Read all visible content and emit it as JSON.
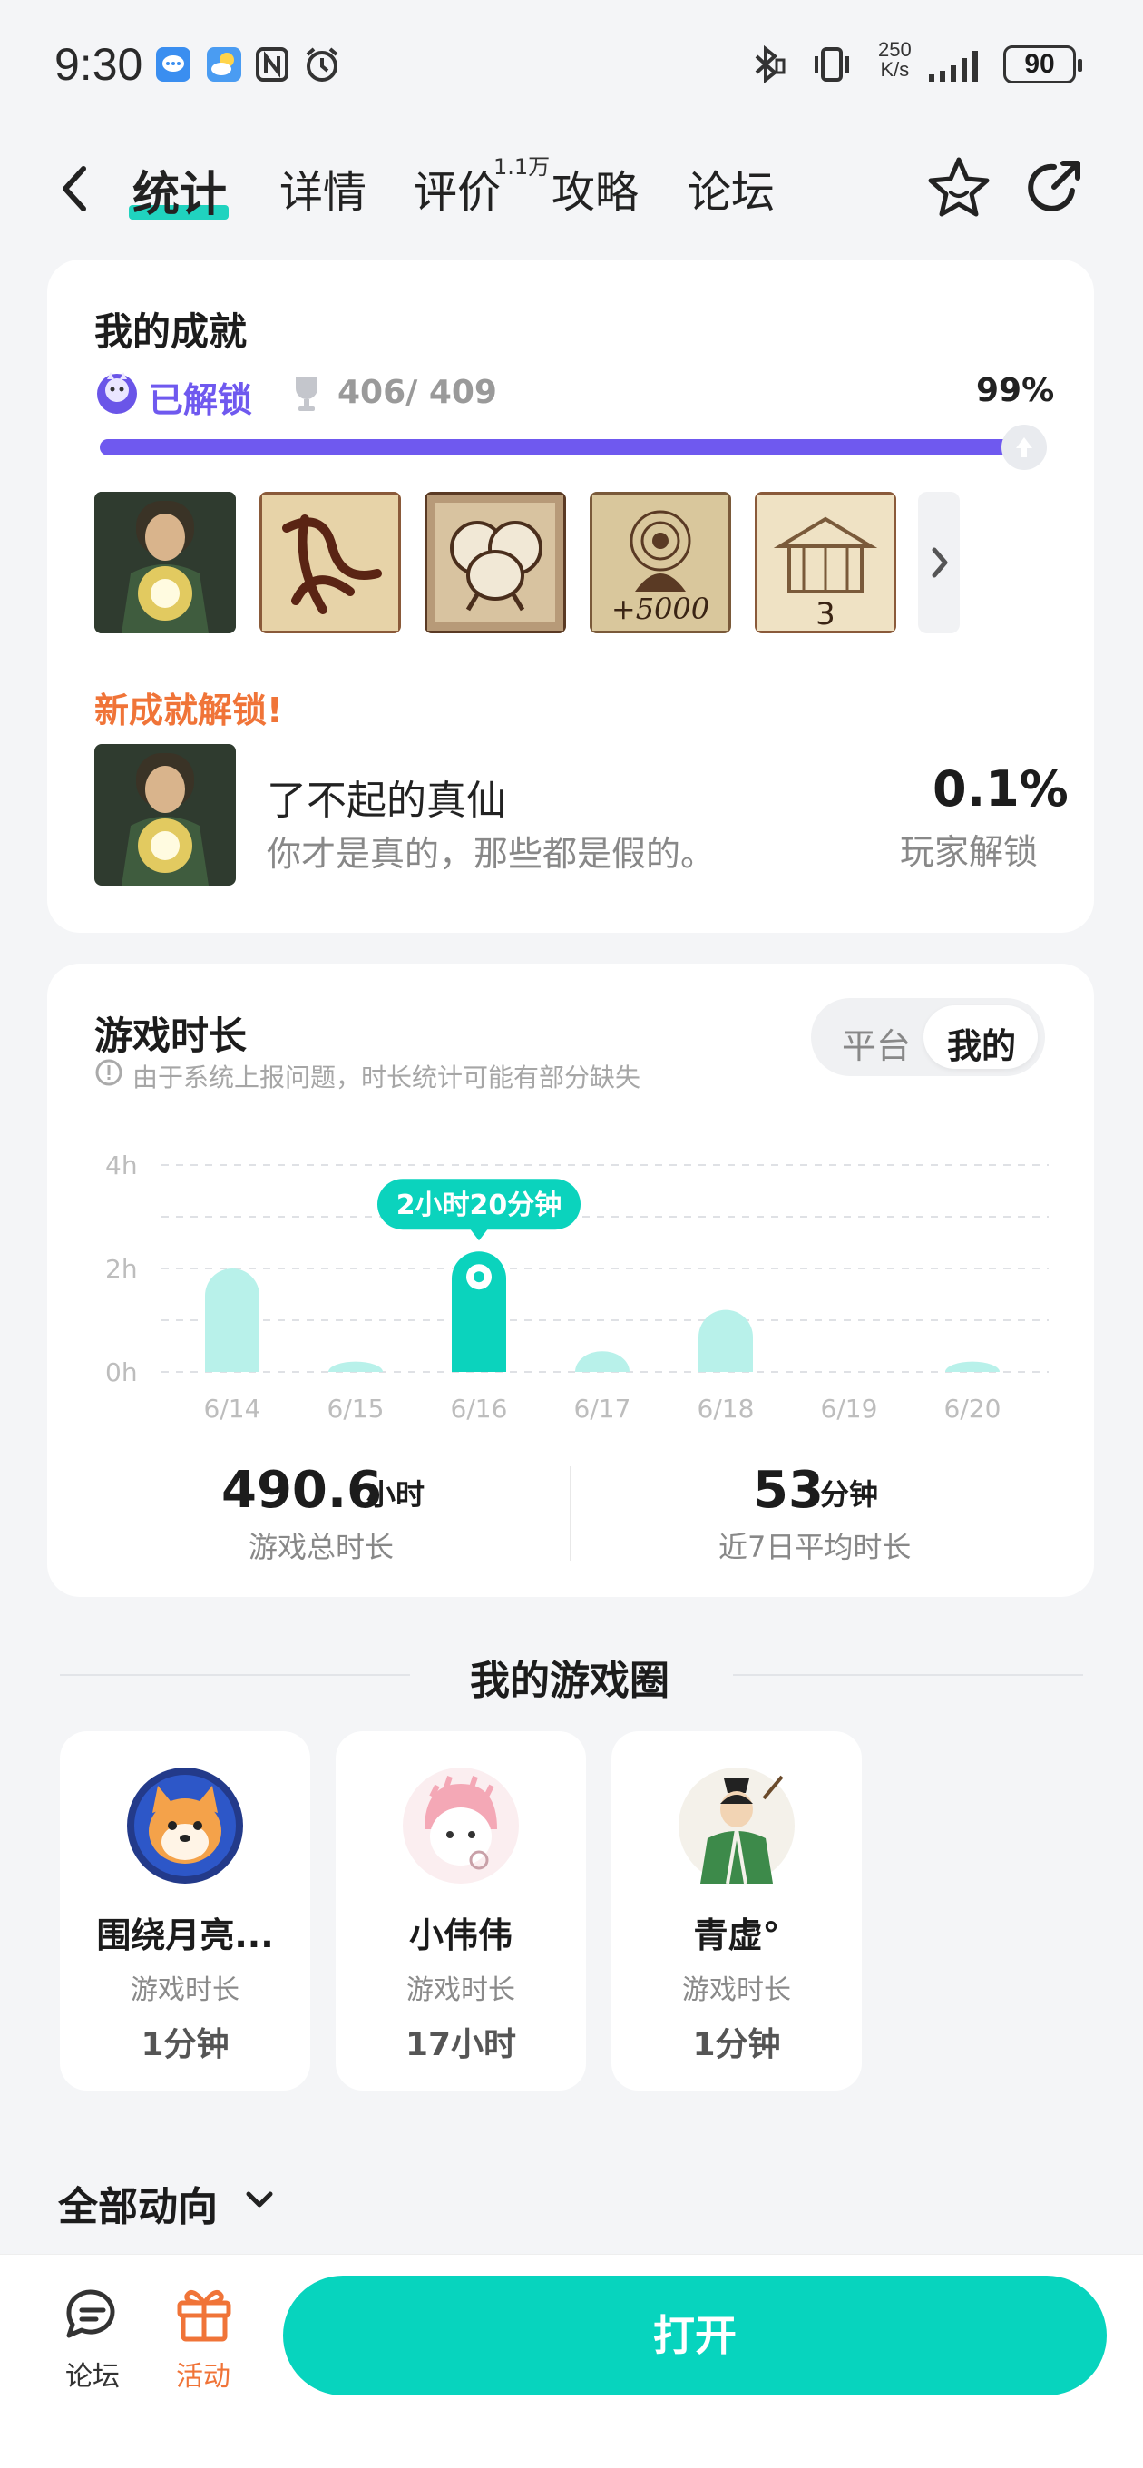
{
  "status_bar": {
    "time": "9:30",
    "net_speed_value": "250",
    "net_speed_unit": "K/s",
    "battery": "90",
    "icons": [
      "messages-icon",
      "weather-icon",
      "nfc-icon",
      "alarm-icon",
      "bluetooth-icon",
      "vibrate-icon",
      "signal-icon",
      "battery-icon"
    ]
  },
  "nav": {
    "tabs": [
      "统计",
      "详情",
      "评价",
      "攻略",
      "论坛"
    ],
    "active_tab": "统计",
    "reviews_badge": "1.1万"
  },
  "achievements": {
    "title": "我的成就",
    "unlocked_label": "已解锁",
    "count": "406/ 409",
    "percent": "99%",
    "progress_fraction": 0.99,
    "thumbnails": [
      "cultivator-immortal",
      "ink-swirl",
      "dancing-cat",
      "meditating-monk-5000",
      "temple-3"
    ],
    "new_label": "新成就解锁!",
    "new_title": "了不起的真仙",
    "new_desc": "你才是真的，那些都是假的。",
    "new_rate": "0.1%",
    "new_rate_label": "玩家解锁"
  },
  "playtime": {
    "title": "游戏时长",
    "notice": "由于系统上报问题，时长统计可能有部分缺失",
    "seg_platform": "平台",
    "seg_mine": "我的",
    "tooltip": "2小时20分钟",
    "total_value": "490.6",
    "total_unit": "小时",
    "total_label": "游戏总时长",
    "avg_value": "53",
    "avg_unit": "分钟",
    "avg_label": "近7日平均时长"
  },
  "chart_data": {
    "type": "bar",
    "categories": [
      "6/14",
      "6/15",
      "6/16",
      "6/17",
      "6/18",
      "6/19",
      "6/20"
    ],
    "values": [
      2.0,
      0.2,
      2.33,
      0.4,
      1.2,
      0,
      0.2
    ],
    "ytick_labels": [
      "4h",
      "2h",
      "0h"
    ],
    "ylim": [
      0,
      4
    ],
    "highlighted_index": 2,
    "grid": true,
    "colors": {
      "bar": "#b8f1ea",
      "highlight": "#0bd3bd"
    }
  },
  "circle": {
    "title": "我的游戏圈",
    "friends": [
      {
        "name": "围绕月亮...",
        "label": "游戏时长",
        "value": "1分钟"
      },
      {
        "name": "小伟伟",
        "label": "游戏时长",
        "value": "17小时"
      },
      {
        "name": "青虚°",
        "label": "游戏时长",
        "value": "1分钟"
      }
    ]
  },
  "feed": {
    "title": "全部动向"
  },
  "bottom_bar": {
    "forum_label": "论坛",
    "activity_label": "活动",
    "open_label": "打开"
  },
  "colors": {
    "accent": "#07d4be",
    "achievement_purple": "#6f59ef",
    "orange": "#f07438"
  }
}
